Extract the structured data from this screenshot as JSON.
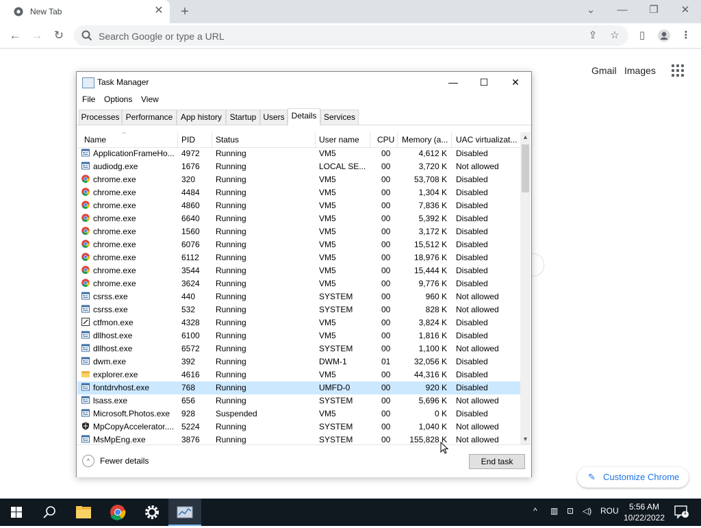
{
  "browser": {
    "tab_title": "New Tab",
    "omnibox_placeholder": "Search Google or type a URL"
  },
  "ntp": {
    "gmail": "Gmail",
    "images": "Images",
    "customize": "Customize Chrome"
  },
  "taskmanager": {
    "title": "Task Manager",
    "menus": [
      "File",
      "Options",
      "View"
    ],
    "tabs": [
      "Processes",
      "Performance",
      "App history",
      "Startup",
      "Users",
      "Details",
      "Services"
    ],
    "active_tab": "Details",
    "columns": [
      "Name",
      "PID",
      "Status",
      "User name",
      "CPU",
      "Memory (a...",
      "UAC virtualizat..."
    ],
    "rows": [
      {
        "icon": "app",
        "name": "ApplicationFrameHo...",
        "pid": "4972",
        "status": "Running",
        "user": "VM5",
        "cpu": "00",
        "mem": "4,612 K",
        "uac": "Disabled"
      },
      {
        "icon": "app",
        "name": "audiodg.exe",
        "pid": "1676",
        "status": "Running",
        "user": "LOCAL SE...",
        "cpu": "00",
        "mem": "3,720 K",
        "uac": "Not allowed"
      },
      {
        "icon": "chrome",
        "name": "chrome.exe",
        "pid": "320",
        "status": "Running",
        "user": "VM5",
        "cpu": "00",
        "mem": "53,708 K",
        "uac": "Disabled"
      },
      {
        "icon": "chrome",
        "name": "chrome.exe",
        "pid": "4484",
        "status": "Running",
        "user": "VM5",
        "cpu": "00",
        "mem": "1,304 K",
        "uac": "Disabled"
      },
      {
        "icon": "chrome",
        "name": "chrome.exe",
        "pid": "4860",
        "status": "Running",
        "user": "VM5",
        "cpu": "00",
        "mem": "7,836 K",
        "uac": "Disabled"
      },
      {
        "icon": "chrome",
        "name": "chrome.exe",
        "pid": "6640",
        "status": "Running",
        "user": "VM5",
        "cpu": "00",
        "mem": "5,392 K",
        "uac": "Disabled"
      },
      {
        "icon": "chrome",
        "name": "chrome.exe",
        "pid": "1560",
        "status": "Running",
        "user": "VM5",
        "cpu": "00",
        "mem": "3,172 K",
        "uac": "Disabled"
      },
      {
        "icon": "chrome",
        "name": "chrome.exe",
        "pid": "6076",
        "status": "Running",
        "user": "VM5",
        "cpu": "00",
        "mem": "15,512 K",
        "uac": "Disabled"
      },
      {
        "icon": "chrome",
        "name": "chrome.exe",
        "pid": "6112",
        "status": "Running",
        "user": "VM5",
        "cpu": "00",
        "mem": "18,976 K",
        "uac": "Disabled"
      },
      {
        "icon": "chrome",
        "name": "chrome.exe",
        "pid": "3544",
        "status": "Running",
        "user": "VM5",
        "cpu": "00",
        "mem": "15,444 K",
        "uac": "Disabled"
      },
      {
        "icon": "chrome",
        "name": "chrome.exe",
        "pid": "3624",
        "status": "Running",
        "user": "VM5",
        "cpu": "00",
        "mem": "9,776 K",
        "uac": "Disabled"
      },
      {
        "icon": "app",
        "name": "csrss.exe",
        "pid": "440",
        "status": "Running",
        "user": "SYSTEM",
        "cpu": "00",
        "mem": "960 K",
        "uac": "Not allowed"
      },
      {
        "icon": "app",
        "name": "csrss.exe",
        "pid": "532",
        "status": "Running",
        "user": "SYSTEM",
        "cpu": "00",
        "mem": "828 K",
        "uac": "Not allowed"
      },
      {
        "icon": "pen",
        "name": "ctfmon.exe",
        "pid": "4328",
        "status": "Running",
        "user": "VM5",
        "cpu": "00",
        "mem": "3,824 K",
        "uac": "Disabled"
      },
      {
        "icon": "app",
        "name": "dllhost.exe",
        "pid": "6100",
        "status": "Running",
        "user": "VM5",
        "cpu": "00",
        "mem": "1,816 K",
        "uac": "Disabled"
      },
      {
        "icon": "app",
        "name": "dllhost.exe",
        "pid": "6572",
        "status": "Running",
        "user": "SYSTEM",
        "cpu": "00",
        "mem": "1,100 K",
        "uac": "Not allowed"
      },
      {
        "icon": "app",
        "name": "dwm.exe",
        "pid": "392",
        "status": "Running",
        "user": "DWM-1",
        "cpu": "01",
        "mem": "32,056 K",
        "uac": "Disabled"
      },
      {
        "icon": "folder",
        "name": "explorer.exe",
        "pid": "4616",
        "status": "Running",
        "user": "VM5",
        "cpu": "00",
        "mem": "44,316 K",
        "uac": "Disabled"
      },
      {
        "icon": "app",
        "name": "fontdrvhost.exe",
        "pid": "768",
        "status": "Running",
        "user": "UMFD-0",
        "cpu": "00",
        "mem": "920 K",
        "uac": "Disabled",
        "selected": true
      },
      {
        "icon": "app",
        "name": "lsass.exe",
        "pid": "656",
        "status": "Running",
        "user": "SYSTEM",
        "cpu": "00",
        "mem": "5,696 K",
        "uac": "Not allowed"
      },
      {
        "icon": "app",
        "name": "Microsoft.Photos.exe",
        "pid": "928",
        "status": "Suspended",
        "user": "VM5",
        "cpu": "00",
        "mem": "0 K",
        "uac": "Disabled"
      },
      {
        "icon": "shield",
        "name": "MpCopyAccelerator....",
        "pid": "5224",
        "status": "Running",
        "user": "SYSTEM",
        "cpu": "00",
        "mem": "1,040 K",
        "uac": "Not allowed"
      },
      {
        "icon": "app",
        "name": "MsMpEng.exe",
        "pid": "3876",
        "status": "Running",
        "user": "SYSTEM",
        "cpu": "00",
        "mem": "155,828 K",
        "uac": "Not allowed"
      }
    ],
    "fewer_details": "Fewer details",
    "end_task": "End task"
  },
  "taskbar": {
    "lang": "ROU",
    "time": "5:56 AM",
    "date": "10/22/2022",
    "notification_count": "1"
  }
}
